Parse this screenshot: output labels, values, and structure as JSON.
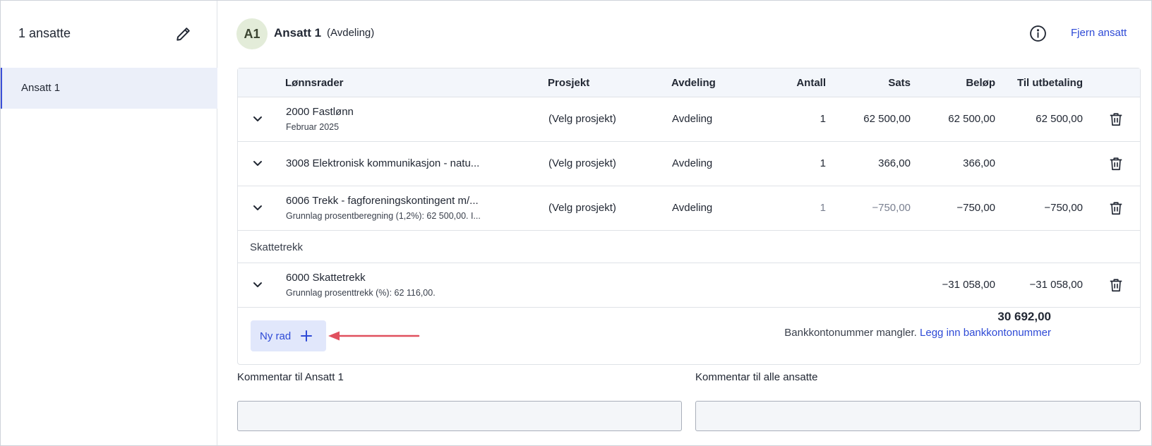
{
  "sidebar": {
    "title": "1 ansatte",
    "items": [
      {
        "label": "Ansatt 1"
      }
    ]
  },
  "header": {
    "avatar": "A1",
    "employee_name": "Ansatt 1",
    "department": "(Avdeling)",
    "remove_label": "Fjern ansatt"
  },
  "table": {
    "columns": {
      "lonnsrader": "Lønnsrader",
      "prosjekt": "Prosjekt",
      "avdeling": "Avdeling",
      "antall": "Antall",
      "sats": "Sats",
      "belop": "Beløp",
      "til_utbetaling": "Til utbetaling"
    },
    "rows": [
      {
        "title": "2000 Fastlønn",
        "subtitle": "Februar 2025",
        "prosjekt": "(Velg prosjekt)",
        "avdeling": "Avdeling",
        "antall": "1",
        "sats": "62 500,00",
        "belop": "62 500,00",
        "til_utbetaling": "62 500,00"
      },
      {
        "title": "3008 Elektronisk kommunikasjon - natu...",
        "subtitle": "",
        "prosjekt": "(Velg prosjekt)",
        "avdeling": "Avdeling",
        "antall": "1",
        "sats": "366,00",
        "belop": "366,00",
        "til_utbetaling": ""
      },
      {
        "title": "6006 Trekk - fagforeningskontingent m/...",
        "subtitle": "Grunnlag prosentberegning (1,2%): 62 500,00. I...",
        "prosjekt": "(Velg prosjekt)",
        "avdeling": "Avdeling",
        "antall": "1",
        "sats": "−750,00",
        "belop": "−750,00",
        "til_utbetaling": "−750,00"
      }
    ],
    "section_label": "Skattetrekk",
    "tax_row": {
      "title": "6000 Skattetrekk",
      "subtitle": "Grunnlag prosenttrekk (%): 62 116,00.",
      "belop": "−31 058,00",
      "til_utbetaling": "−31 058,00"
    },
    "new_row_label": "Ny rad",
    "total": "30 692,00",
    "bank_missing": "Bankkontonummer mangler.",
    "bank_link": "Legg inn bankkontonummer"
  },
  "comments": {
    "employee_label": "Kommentar til Ansatt 1",
    "all_label": "Kommentar til alle ansatte",
    "employee_value": "",
    "all_value": ""
  },
  "colors": {
    "accent": "#2e4ad6",
    "sidebar_selected_bg": "#ebeff9",
    "header_bg": "#f3f6fb",
    "arrow": "#e0505e"
  },
  "icons": [
    "pencil-icon",
    "info-icon",
    "chevron-down-icon",
    "trash-icon",
    "plus-icon"
  ]
}
